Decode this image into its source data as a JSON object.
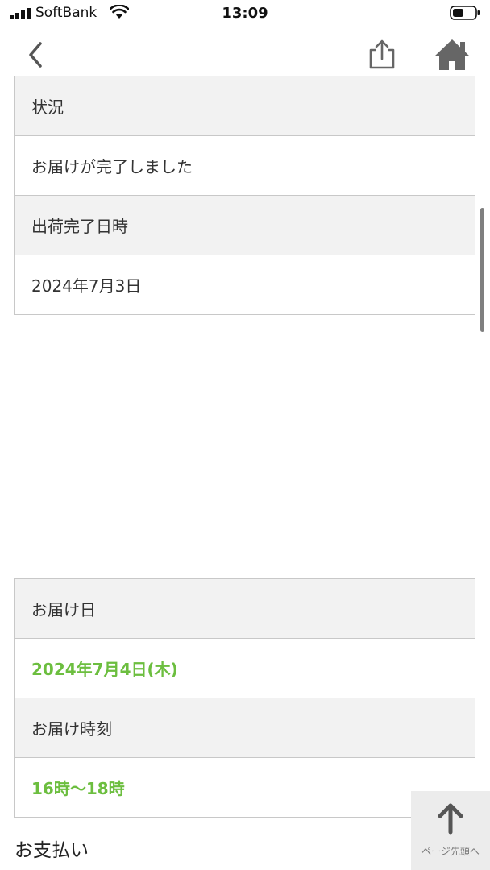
{
  "status_bar": {
    "carrier": "SoftBank",
    "time": "13:09"
  },
  "nav": {
    "back_icon": "chevron-left-icon",
    "share_icon": "share-icon",
    "home_icon": "home-icon"
  },
  "shipment": {
    "rows": [
      {
        "label": "状況"
      },
      {
        "value": "お届けが完了しました"
      },
      {
        "label": "出荷完了日時"
      },
      {
        "value": "2024年7月3日"
      }
    ]
  },
  "delivery": {
    "date_label": "お届け日",
    "date_value": "2024年7月4日(木)",
    "time_label": "お届け時刻",
    "time_value": "16時〜18時"
  },
  "payment": {
    "title": "お支払い"
  },
  "page_top": {
    "label": "ページ先頭へ",
    "icon": "arrow-up-icon"
  },
  "colors": {
    "accent_green": "#6cbe3f",
    "header_bg": "#f2f2f2",
    "border": "#c8c8c8"
  }
}
